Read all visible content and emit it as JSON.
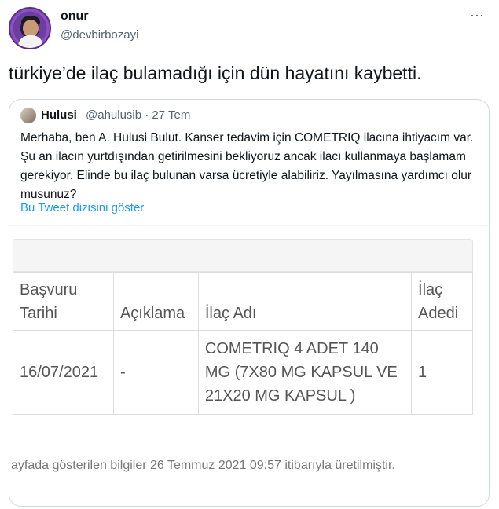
{
  "author": {
    "display_name": "onur",
    "handle": "@devbirbozayi"
  },
  "tweet": {
    "text": "türkiye’de ilaç bulamadığı için dün hayatını kaybetti.",
    "more_glyph": "⋯"
  },
  "quote": {
    "display_name": "Hulusi",
    "handle_date": "@ahulusib · 27 Tem",
    "body": "Merhaba, ben A. Hulusi Bulut. Kanser tedavim için COMETRIQ ilacına ihtiyacım var. Şu an ilacın yurtdışından getirilmesini bekliyoruz ancak ilacı kullanmaya başlamam gerekiyor. Elinde bu ilaç bulunan varsa ücretiyle alabiliriz. Yayılmasına yardımcı olur musunuz?",
    "show_thread": "Bu Tweet dizisini göster"
  },
  "table": {
    "headers": [
      "Başvuru Tarihi",
      "Açıklama",
      "İlaç Adı",
      "İlaç Adedi"
    ],
    "row": [
      "16/07/2021",
      "-",
      "COMETRIQ 4 ADET 140 MG (7X80 MG KAPSUL VE 21X20 MG KAPSUL )",
      "1"
    ],
    "footer": "ayfada gösterilen bilgiler 26 Temmuz 2021 09:57 itibarıyla üretilmiştir."
  },
  "colors": {
    "link": "#1d9bf0",
    "secondary_text": "#536471"
  }
}
